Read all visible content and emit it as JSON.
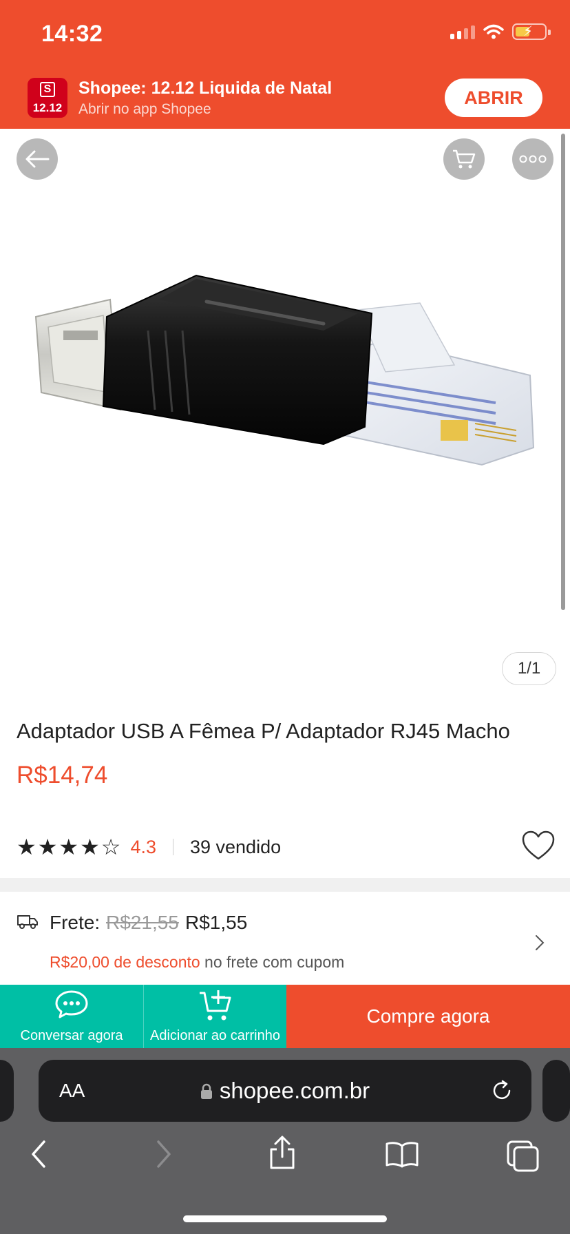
{
  "status_bar": {
    "time": "14:32"
  },
  "app_banner": {
    "logo_text": "12.12",
    "logo_bag_letter": "S",
    "title": "Shopee: 12.12 Liquida de Natal",
    "subtitle": "Abrir no app Shopee",
    "open_label": "ABRIR"
  },
  "gallery": {
    "counter": "1/1"
  },
  "product": {
    "title": "Adaptador USB A Fêmea P/ Adaptador RJ45 Macho",
    "price": "R$14,74",
    "rating": "4.3",
    "rating_value": 4.3,
    "rating_max": 5,
    "sold": "39 vendido"
  },
  "shipping": {
    "label": "Frete:",
    "old_price": "R$21,55",
    "new_price": "R$1,55",
    "discount_highlight": "R$20,00 de desconto",
    "discount_rest": " no frete com cupom"
  },
  "actions": {
    "chat_label": "Conversar agora",
    "cart_label": "Adicionar ao carrinho",
    "buy_label": "Compre agora"
  },
  "browser": {
    "text_size_label": "AA",
    "domain": "shopee.com.br"
  },
  "colors": {
    "brand": "#ee4d2d",
    "teal": "#00bfa5",
    "star": "#f6a700"
  }
}
